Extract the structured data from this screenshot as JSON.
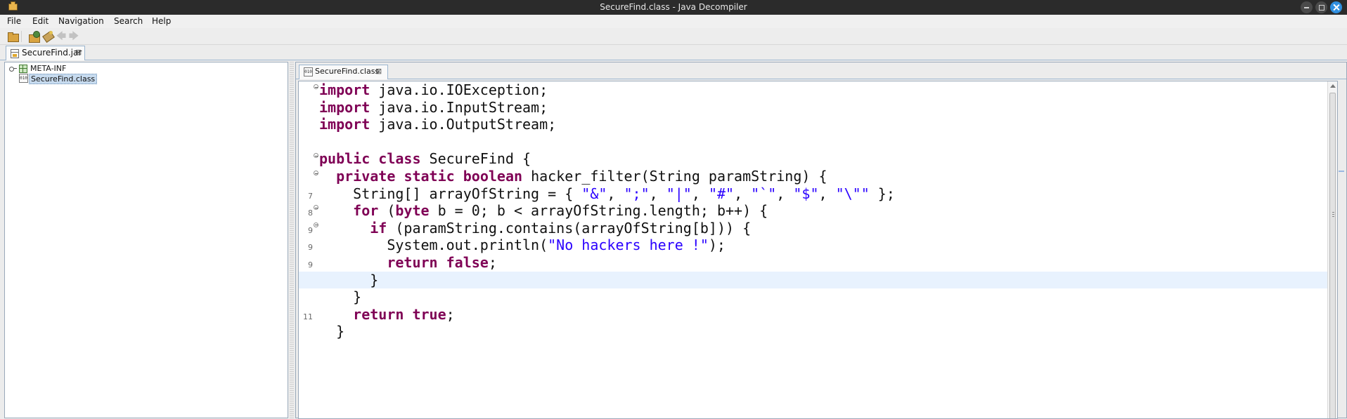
{
  "window": {
    "title": "SecureFind.class - Java Decompiler"
  },
  "menu": [
    "File",
    "Edit",
    "Navigation",
    "Search",
    "Help"
  ],
  "toolbar": {
    "icons": [
      "open-file-icon",
      "open-type-icon",
      "search-icon",
      "back-icon",
      "forward-icon"
    ],
    "back_glyph": "🡄",
    "forward_glyph": "🡆"
  },
  "outer_tab": {
    "label": "SecureFind.jar",
    "close": "⊠"
  },
  "tree": {
    "items": [
      {
        "label": "META-INF",
        "type": "package"
      },
      {
        "label": "SecureFind.class",
        "type": "class",
        "selected": true
      }
    ],
    "class_icon_text": "010"
  },
  "editor_tab": {
    "label": "SecureFind.class",
    "close": "⊠"
  },
  "code": {
    "lines": [
      {
        "num": "",
        "fold": true,
        "current": false,
        "tokens": [
          {
            "t": "import",
            "c": "kw"
          },
          {
            "t": " java.io.IOException;"
          }
        ]
      },
      {
        "num": "",
        "fold": false,
        "current": false,
        "tokens": [
          {
            "t": "import",
            "c": "kw"
          },
          {
            "t": " java.io.InputStream;"
          }
        ]
      },
      {
        "num": "",
        "fold": false,
        "current": false,
        "tokens": [
          {
            "t": "import",
            "c": "kw"
          },
          {
            "t": " java.io.OutputStream;"
          }
        ]
      },
      {
        "num": "",
        "fold": false,
        "current": false,
        "tokens": []
      },
      {
        "num": "",
        "fold": true,
        "current": false,
        "tokens": [
          {
            "t": "public",
            "c": "kw"
          },
          {
            "t": " "
          },
          {
            "t": "class",
            "c": "kw"
          },
          {
            "t": " SecureFind {"
          }
        ]
      },
      {
        "num": "",
        "fold": true,
        "current": false,
        "tokens": [
          {
            "t": "  "
          },
          {
            "t": "private",
            "c": "kw"
          },
          {
            "t": " "
          },
          {
            "t": "static",
            "c": "kw"
          },
          {
            "t": " "
          },
          {
            "t": "boolean",
            "c": "kw"
          },
          {
            "t": " hacker_filter(String paramString) {"
          }
        ]
      },
      {
        "num": "7",
        "fold": false,
        "current": false,
        "tokens": [
          {
            "t": "    String[] arrayOfString = { "
          },
          {
            "t": "\"&\"",
            "c": "str"
          },
          {
            "t": ", "
          },
          {
            "t": "\";\"",
            "c": "str"
          },
          {
            "t": ", "
          },
          {
            "t": "\"|\"",
            "c": "str"
          },
          {
            "t": ", "
          },
          {
            "t": "\"#\"",
            "c": "str"
          },
          {
            "t": ", "
          },
          {
            "t": "\"`\"",
            "c": "str"
          },
          {
            "t": ", "
          },
          {
            "t": "\"$\"",
            "c": "str"
          },
          {
            "t": ", "
          },
          {
            "t": "\"\\\"\"",
            "c": "str"
          },
          {
            "t": " };"
          }
        ]
      },
      {
        "num": "8",
        "fold": true,
        "current": false,
        "tokens": [
          {
            "t": "    "
          },
          {
            "t": "for",
            "c": "kw"
          },
          {
            "t": " ("
          },
          {
            "t": "byte",
            "c": "kw"
          },
          {
            "t": " b = 0; b < arrayOfString.length; b++) {"
          }
        ]
      },
      {
        "num": "9",
        "fold": true,
        "current": false,
        "tokens": [
          {
            "t": "      "
          },
          {
            "t": "if",
            "c": "kw"
          },
          {
            "t": " (paramString.contains(arrayOfString[b])) {"
          }
        ]
      },
      {
        "num": "9",
        "fold": false,
        "current": false,
        "tokens": [
          {
            "t": "        System.out.println("
          },
          {
            "t": "\"No hackers here !\"",
            "c": "str"
          },
          {
            "t": ");"
          }
        ]
      },
      {
        "num": "9",
        "fold": false,
        "current": false,
        "tokens": [
          {
            "t": "        "
          },
          {
            "t": "return",
            "c": "kw"
          },
          {
            "t": " "
          },
          {
            "t": "false",
            "c": "kw"
          },
          {
            "t": ";"
          }
        ]
      },
      {
        "num": "",
        "fold": false,
        "current": true,
        "tokens": [
          {
            "t": "      }"
          }
        ]
      },
      {
        "num": "",
        "fold": false,
        "current": false,
        "tokens": [
          {
            "t": "    }"
          }
        ]
      },
      {
        "num": "11",
        "fold": false,
        "current": false,
        "tokens": [
          {
            "t": "    "
          },
          {
            "t": "return",
            "c": "kw"
          },
          {
            "t": " "
          },
          {
            "t": "true",
            "c": "kw"
          },
          {
            "t": ";"
          }
        ]
      },
      {
        "num": "",
        "fold": false,
        "current": false,
        "tokens": [
          {
            "t": "  }"
          }
        ]
      }
    ]
  }
}
